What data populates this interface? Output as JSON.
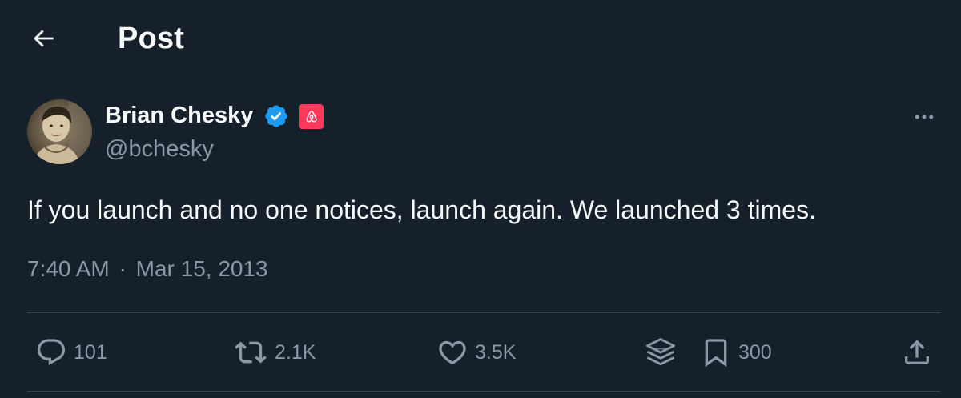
{
  "header": {
    "back_icon": "arrow-left-icon",
    "title": "Post"
  },
  "tweet": {
    "author": {
      "name": "Brian Chesky",
      "handle": "@bchesky",
      "verified_icon": "verified-badge-icon",
      "affiliation_icon": "airbnb-logo-icon",
      "avatar": "avatar-photo"
    },
    "more_icon": "more-horizontal-icon",
    "text": "If you launch and no one notices, launch again. We launched 3 times.",
    "time": "7:40 AM",
    "separator": "·",
    "date": "Mar 15, 2013"
  },
  "actions": {
    "reply": {
      "icon": "reply-icon",
      "count": "101"
    },
    "repost": {
      "icon": "repost-icon",
      "count": "2.1K"
    },
    "like": {
      "icon": "heart-icon",
      "count": "3.5K"
    },
    "grok": {
      "icon": "layers-icon"
    },
    "bookmark": {
      "icon": "bookmark-icon",
      "count": "300"
    },
    "share": {
      "icon": "share-icon"
    }
  },
  "colors": {
    "background": "#15202b",
    "text_primary": "#f7f9f9",
    "text_secondary": "#8b98a5",
    "divider": "#38444d",
    "verified_blue": "#1d9bf0",
    "airbnb_brand": "#ff385c"
  }
}
